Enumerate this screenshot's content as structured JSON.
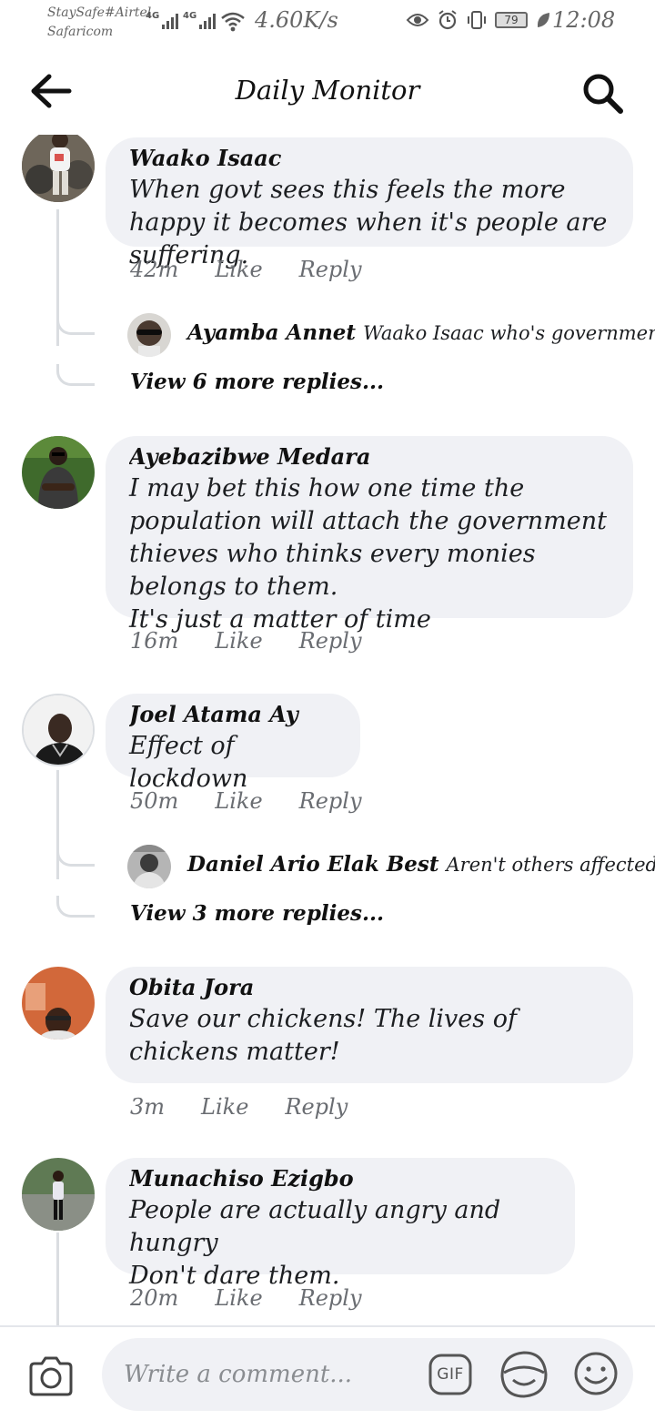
{
  "status_bar": {
    "carrier_line1": "StaySafe#Airtel",
    "carrier_line2": "Safaricom",
    "sim1_label": "4G",
    "sim2_label": "4G",
    "net_speed": "4.60K/s",
    "battery": "79",
    "time": "12:08"
  },
  "header": {
    "title": "Daily Monitor",
    "back_icon": "back-arrow-icon",
    "search_icon": "search-icon"
  },
  "comments": [
    {
      "name": "Waako Isaac",
      "text": "When govt sees this feels the more happy it becomes when it's people are suffering.",
      "time": "42m",
      "like": "Like",
      "reply": "Reply",
      "reply_preview": {
        "name": "Ayamba Annet",
        "text": "Waako Isaac who's governmen..."
      },
      "more_replies": "View 6 more replies..."
    },
    {
      "name": "Ayebazibwe Medara",
      "text": "I may bet this how one time the population will attach the government thieves who thinks every monies belongs to them.\nIt's just a matter of time",
      "time": "16m",
      "like": "Like",
      "reply": "Reply"
    },
    {
      "name": "Joel Atama Ay",
      "text": "Effect of lockdown",
      "time": "50m",
      "like": "Like",
      "reply": "Reply",
      "reply_preview": {
        "name": "Daniel Ario Elak Best",
        "text": "Aren't others affected too?"
      },
      "more_replies": "View 3 more replies..."
    },
    {
      "name": "Obita Jora",
      "text": "Save our chickens! The lives of chickens matter!",
      "time": "3m",
      "like": "Like",
      "reply": "Reply"
    },
    {
      "name": "Munachiso Ezigbo",
      "text": "People are actually angry and hungry\nDon't dare them.",
      "time": "20m",
      "like": "Like",
      "reply": "Reply"
    }
  ],
  "composer": {
    "placeholder": "Write a comment...",
    "gif_label": "GIF"
  }
}
